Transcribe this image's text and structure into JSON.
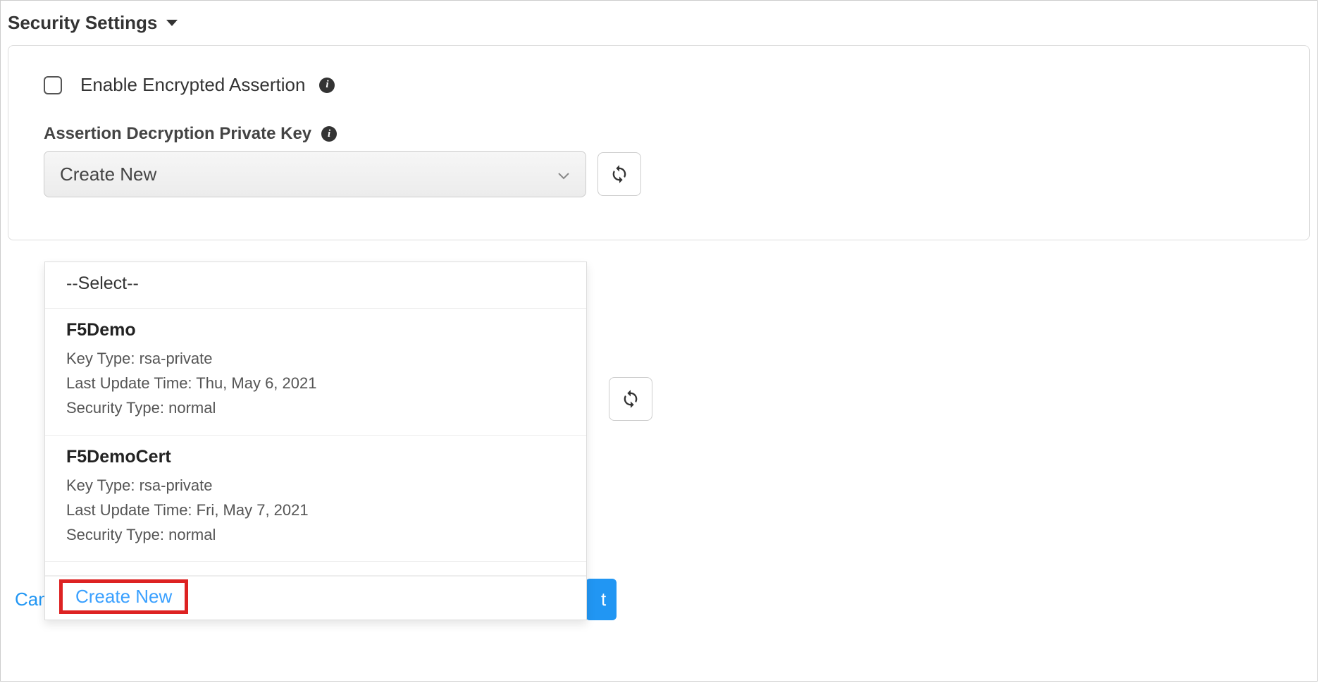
{
  "section": {
    "title": "Security Settings"
  },
  "encrypt": {
    "label": "Enable Encrypted Assertion"
  },
  "private_key": {
    "label": "Assertion Decryption Private Key",
    "selected": "Create New",
    "options_placeholder": "--Select--",
    "options": [
      {
        "name": "F5Demo",
        "key_type_label": "Key Type:",
        "key_type": "rsa-private",
        "update_label": "Last Update Time:",
        "update": "Thu, May 6, 2021",
        "sec_label": "Security Type:",
        "sec": "normal"
      },
      {
        "name": "F5DemoCert",
        "key_type_label": "Key Type:",
        "key_type": "rsa-private",
        "update_label": "Last Update Time:",
        "update": "Fri, May 7, 2021",
        "sec_label": "Security Type:",
        "sec": "normal"
      }
    ],
    "create_new": "Create New"
  },
  "footer": {
    "cancel": "Cancel",
    "next_fragment": "t"
  }
}
